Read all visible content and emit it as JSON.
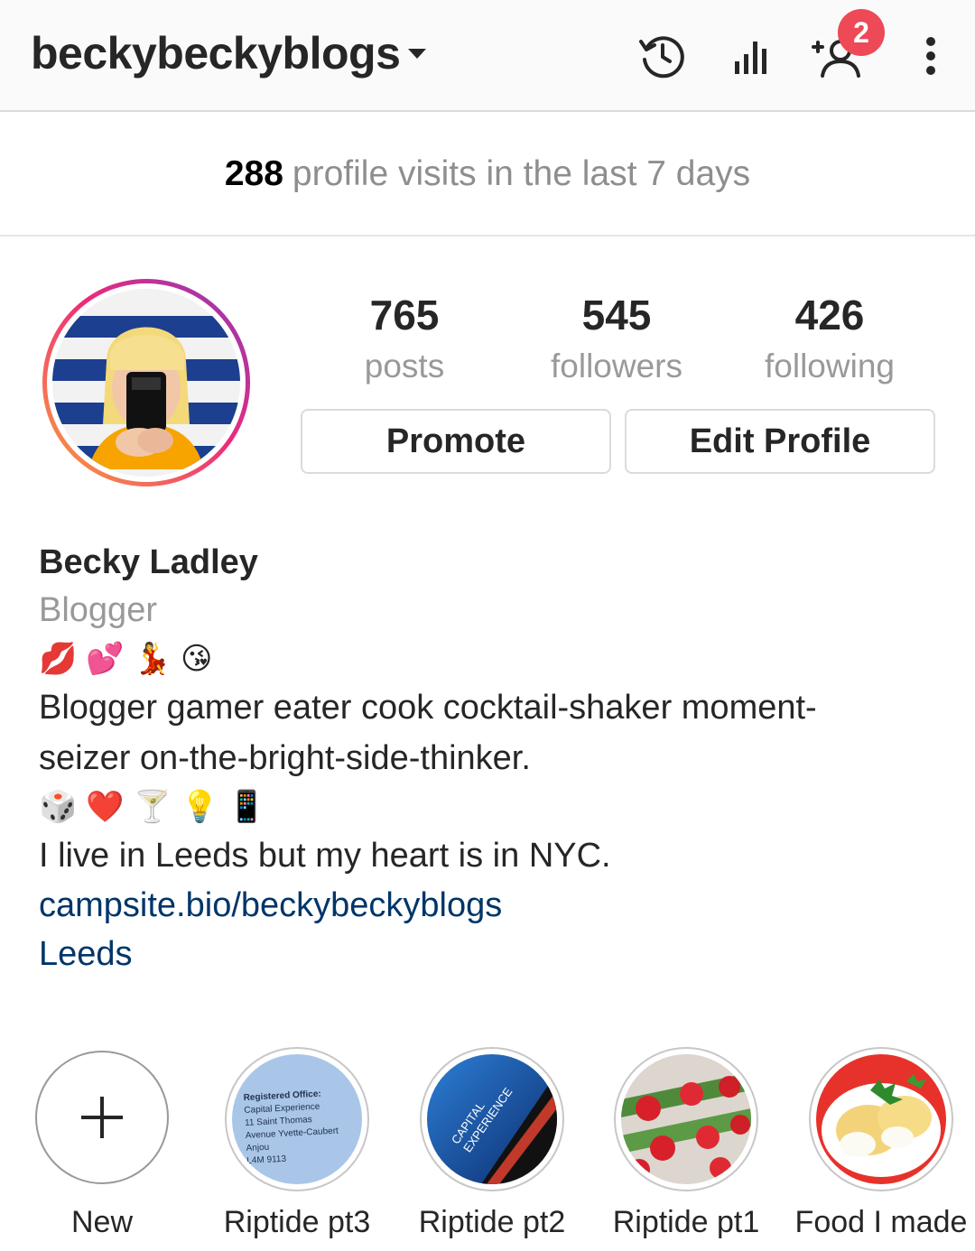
{
  "header": {
    "username": "beckybeckyblogs",
    "notification_count": "2",
    "icons": [
      "chevron-down-icon",
      "history-icon",
      "insights-icon",
      "discover-people-icon",
      "more-options-icon"
    ]
  },
  "visits": {
    "count": "288",
    "text": "profile visits in the last 7 days"
  },
  "stats": [
    {
      "value": "765",
      "label": "posts"
    },
    {
      "value": "545",
      "label": "followers"
    },
    {
      "value": "426",
      "label": "following"
    }
  ],
  "buttons": {
    "promote": "Promote",
    "edit_profile": "Edit Profile"
  },
  "bio": {
    "name": "Becky Ladley",
    "category": "Blogger",
    "emoji_line_1": [
      "💋",
      "💕",
      "💃",
      "😘"
    ],
    "line_1": "Blogger gamer eater cook cocktail-shaker moment-",
    "line_2": "seizer on-the-bright-side-thinker.",
    "emoji_line_2": [
      "🎲",
      "❤️",
      "🍸",
      "💡",
      "📱"
    ],
    "line_3": "I live in Leeds but my heart is in NYC.",
    "link": "campsite.bio/beckybeckyblogs",
    "location": "Leeds"
  },
  "highlights": [
    {
      "label": "New"
    },
    {
      "label": "Riptide pt3"
    },
    {
      "label": "Riptide pt2"
    },
    {
      "label": "Riptide pt1"
    },
    {
      "label": "Food I made"
    }
  ],
  "highlight_art": {
    "riptide_pt3_text": [
      "Registered Office:",
      "Capital Experience",
      "11 Saint Thomas",
      "Avenue Yvette-Caubert",
      "Anjou",
      "L4M 9113"
    ],
    "riptide_pt2_text": [
      "CAPITAL",
      "EXPERIENCE"
    ]
  },
  "colors": {
    "accent_link": "#003569",
    "badge": "#ed4956",
    "muted_text": "#999999"
  }
}
